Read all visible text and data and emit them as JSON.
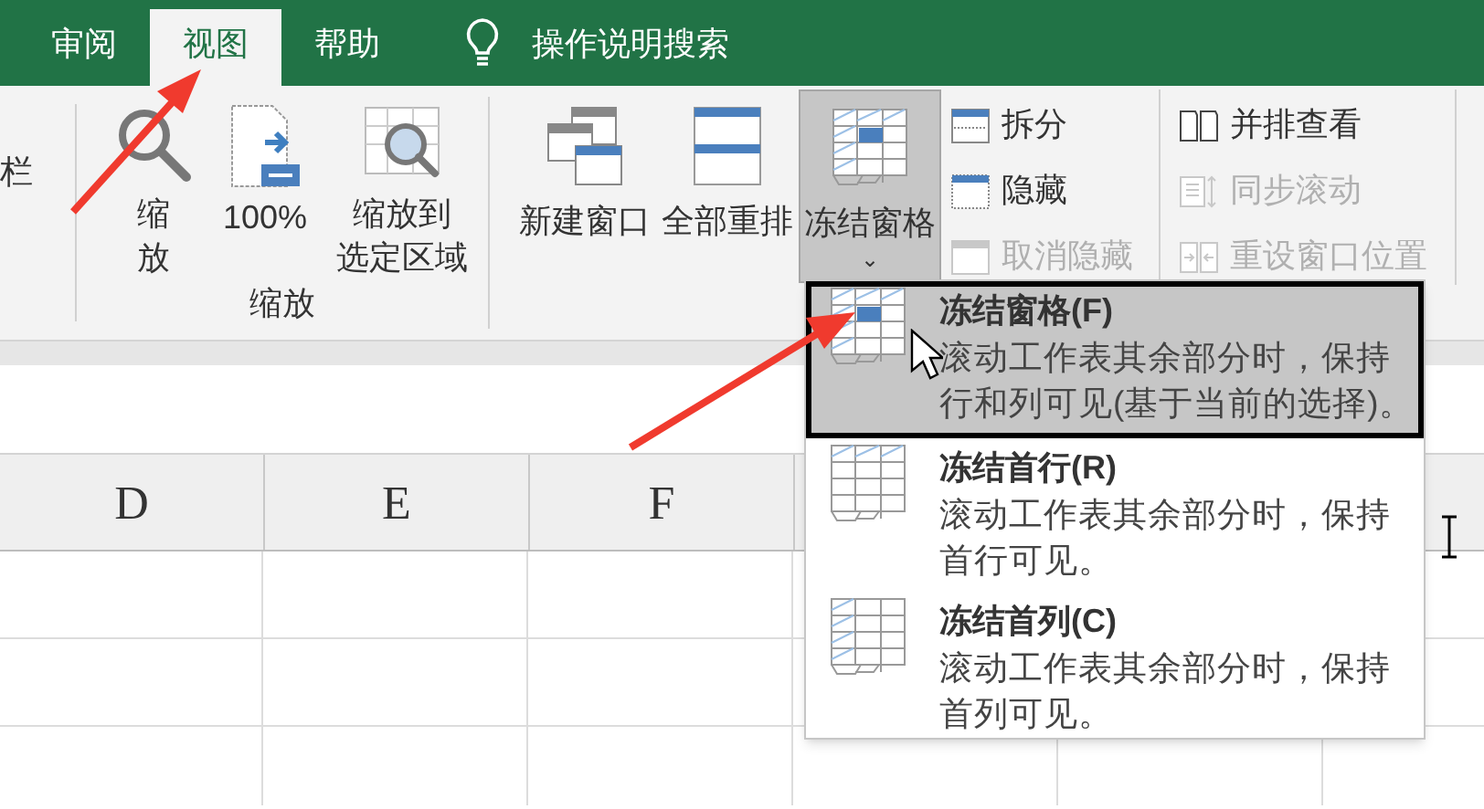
{
  "ribbon_tabs": [
    {
      "label": "审阅",
      "selected": false
    },
    {
      "label": "视图",
      "selected": true
    },
    {
      "label": "帮助",
      "selected": false
    }
  ],
  "tell_me": {
    "label": "操作说明搜索"
  },
  "ribbon": {
    "cut_text": "栏",
    "zoom_group": {
      "label": "缩放",
      "buttons": [
        {
          "label": "缩放",
          "kind": "zoom"
        },
        {
          "label": "100%",
          "kind": "hundred"
        },
        {
          "label": "缩放到选定区域",
          "kind": "selection"
        }
      ]
    },
    "window_group": {
      "large_buttons": [
        {
          "label": "新建窗口",
          "kind": "new_window",
          "pressed": false
        },
        {
          "label": "全部重排",
          "kind": "arrange",
          "pressed": false
        },
        {
          "label": "冻结窗格",
          "kind": "freeze",
          "pressed": true,
          "caret": "⌄"
        }
      ],
      "small_columns": [
        [
          {
            "label": "拆分",
            "kind": "split",
            "disabled": false
          },
          {
            "label": "隐藏",
            "kind": "hide",
            "disabled": false
          },
          {
            "label": "取消隐藏",
            "kind": "unhide",
            "disabled": true
          }
        ],
        [
          {
            "label": "并排查看",
            "kind": "side_by_side",
            "disabled": false
          },
          {
            "label": "同步滚动",
            "kind": "sync_scroll",
            "disabled": true
          },
          {
            "label": "重设窗口位置",
            "kind": "reset_position",
            "disabled": true
          }
        ]
      ]
    }
  },
  "columns": [
    "D",
    "E",
    "F"
  ],
  "freeze_menu": {
    "items": [
      {
        "kind": "panes",
        "title": "冻结窗格(F)",
        "description": "滚动工作表其余部分时，保持行和列可见(基于当前的选择)。",
        "selected": true
      },
      {
        "kind": "top_row",
        "title": "冻结首行(R)",
        "description": "滚动工作表其余部分时，保持首行可见。",
        "selected": false
      },
      {
        "kind": "first_column",
        "title": "冻结首列(C)",
        "description": "滚动工作表其余部分时，保持首列可见。",
        "selected": false
      }
    ]
  }
}
